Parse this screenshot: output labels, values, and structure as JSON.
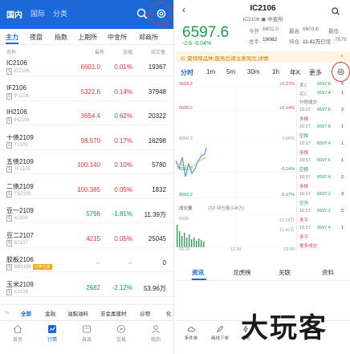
{
  "left": {
    "header_tabs": [
      {
        "label": "国内",
        "active": true
      },
      {
        "label": "国际",
        "active": false
      },
      {
        "label": "分类",
        "active": false
      }
    ],
    "icons": [
      "search-icon",
      "gear-icon"
    ],
    "sub_tabs": [
      "主力",
      "夜盘",
      "指数",
      "上期所",
      "中金所",
      "郑商所"
    ],
    "columns": {
      "name": "名称",
      "latest": "最新",
      "change": "涨幅",
      "volume": "成交量"
    },
    "rows": [
      {
        "name": "IC2106",
        "code": "IC2106",
        "price": "6601.0",
        "pct": "0.01%",
        "vol": "19367",
        "dir": "up"
      },
      {
        "name": "IF2106",
        "code": "IF2106",
        "price": "5322.6",
        "pct": "0.14%",
        "vol": "37948",
        "dir": "up"
      },
      {
        "name": "IH2106",
        "code": "IH2106",
        "price": "3654.4",
        "pct": "0.62%",
        "vol": "20322",
        "dir": "up"
      },
      {
        "name": "十债2109",
        "code": "T2109",
        "price": "98.570",
        "pct": "0.17%",
        "vol": "16298",
        "dir": "up"
      },
      {
        "name": "五债2109",
        "code": "TF2109",
        "price": "100.140",
        "pct": "0.10%",
        "vol": "5780",
        "dir": "up"
      },
      {
        "name": "二债2109",
        "code": "TS2109",
        "price": "100.385",
        "pct": "0.05%",
        "vol": "1832",
        "dir": "up"
      },
      {
        "name": "豆一2109",
        "code": "A2109",
        "price": "5796",
        "pct": "-1.81%",
        "vol": "11.39万",
        "dir": "dn"
      },
      {
        "name": "豆二2107",
        "code": "B2107",
        "price": "4215",
        "pct": "0.05%",
        "vol": "25045",
        "dir": "up"
      },
      {
        "name": "胶板2106",
        "code": "BB2106",
        "price": "--",
        "pct": "--",
        "vol": "0",
        "dir": "flat",
        "badge": "日停交易"
      },
      {
        "name": "玉米2109",
        "code": "C2109",
        "price": "2682",
        "pct": "-2.12%",
        "vol": "53.96万",
        "dir": "dn"
      }
    ],
    "categories": [
      "全部",
      "金融",
      "油脂油料",
      "非金属建材",
      "谷物",
      "化"
    ],
    "nav": [
      "首页",
      "行情",
      "自选",
      "交易",
      "我的"
    ]
  },
  "right": {
    "title": "IC2106",
    "subtitle": "IC2106 ▣ 中金所",
    "price": "6597.6",
    "change": "-2.6  -0.04%",
    "stats": {
      "open_label": "今开",
      "open": "6602.0",
      "high_label": "最高",
      "high": "6603.6",
      "low_label": "最低",
      "low": "6574.2",
      "hold_label": "总手",
      "hold": "19082",
      "amount_label": "持仓",
      "amount": "11.41万",
      "day_label": "日增",
      "day": "-7679"
    },
    "notice": "IC 夏特降品种,服务后请注意风险,详情",
    "period_tabs": [
      "分时",
      "1m",
      "5m",
      "30m",
      "1h",
      "年K",
      "更多"
    ],
    "chart_labels": {
      "p_top": "6618.2",
      "p_2": "6609.2",
      "p_mid": "6600.2",
      "p_4": "6591.2",
      "p_bot": "6582.2",
      "pct_top": "+0.27%",
      "pct_2": "+0.14%",
      "pct_mid": "0.00%",
      "pct_4": "-0.14%",
      "pct_bot": "-0.27%",
      "vol_label": "成交量",
      "vol_value": "218 持仓量(148万)",
      "vol_top": "5693",
      "vol_bot": "1",
      "t0": "09:30",
      "t1": "11:30",
      "t2": "15:00",
      "right_vol1": "12.09万",
      "right_vol2": "11.41万"
    },
    "orderbook": [
      {
        "label": "卖1",
        "price": "6597.8",
        "vol": "6"
      },
      {
        "label": "买1",
        "price": "6597.4",
        "vol": "1"
      },
      {
        "label": "分时成交",
        "price": "",
        "vol": ""
      },
      {
        "label": "10:17",
        "price": "6597.6",
        "vol": "2"
      },
      {
        "label": "多换",
        "price": "",
        "vol": ""
      },
      {
        "label": "10:17",
        "price": "6597.8",
        "vol": "1"
      },
      {
        "label": "空换",
        "price": "",
        "vol": ""
      },
      {
        "label": "10:17",
        "price": "6597.4",
        "vol": "1"
      },
      {
        "label": "多换",
        "price": "",
        "vol": ""
      },
      {
        "label": "10:17",
        "price": "6597.6",
        "vol": "1"
      },
      {
        "label": "空换",
        "price": "",
        "vol": ""
      },
      {
        "label": "10:17",
        "price": "6597.4",
        "vol": "2"
      },
      {
        "label": "多换",
        "price": "",
        "vol": ""
      },
      {
        "label": "10:17",
        "price": "6597.2",
        "vol": "3"
      },
      {
        "label": "空开",
        "price": "",
        "vol": ""
      },
      {
        "label": "10:17",
        "price": "6597.2",
        "vol": "2"
      },
      {
        "label": "多平",
        "price": "",
        "vol": ""
      },
      {
        "label": "10:17",
        "price": "6597.4",
        "vol": "1"
      },
      {
        "label": "多平",
        "price": "",
        "vol": ""
      },
      {
        "label": "更多成交",
        "price": "",
        "vol": ""
      }
    ],
    "info_tabs": [
      "资讯",
      "龙虎榜",
      "关联",
      "资料"
    ],
    "bottom_nav": [
      "条件单",
      "画线下单",
      "闪电",
      "设置",
      "买入",
      "卖出"
    ]
  },
  "watermark": "大玩客",
  "accent": "#1b68d8",
  "up_color": "#e2393e",
  "down_color": "#16a34a"
}
